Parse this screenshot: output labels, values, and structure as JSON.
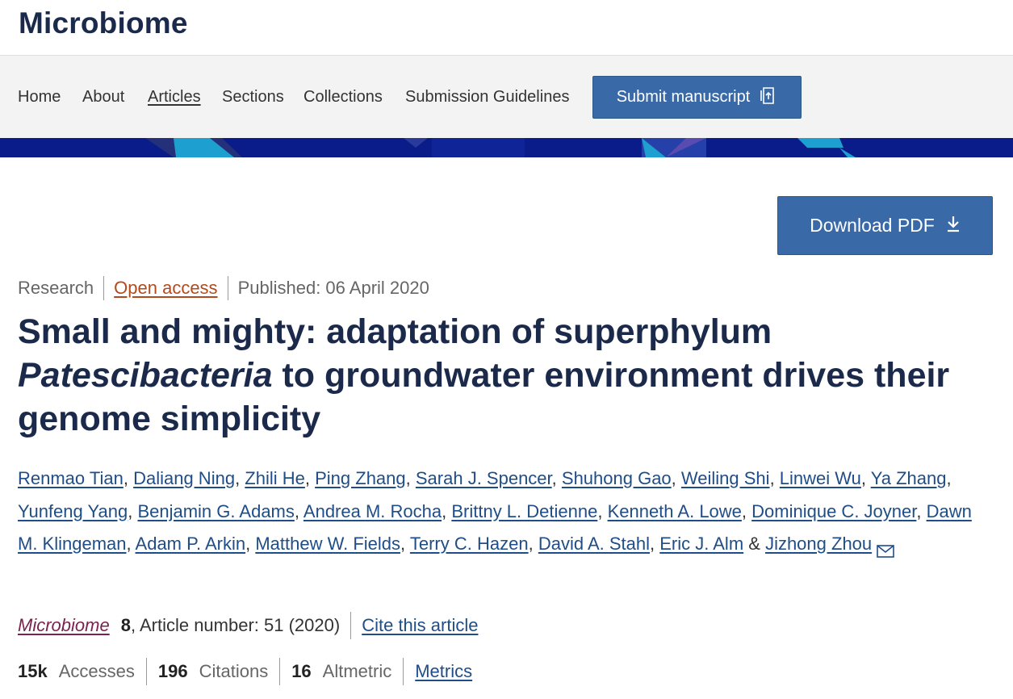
{
  "header": {
    "journal_title": "Microbiome"
  },
  "nav": {
    "items": [
      {
        "label": "Home"
      },
      {
        "label": "About"
      },
      {
        "label": "Articles"
      },
      {
        "label": "Sections"
      },
      {
        "label": "Collections"
      },
      {
        "label": "Submission Guidelines"
      }
    ],
    "submit_label": "Submit manuscript"
  },
  "download_pdf_label": "Download PDF",
  "article": {
    "type": "Research",
    "access": "Open access",
    "published": "Published: 06 April 2020",
    "title_part1": "Small and mighty: adaptation of superphylum",
    "title_italic": "Patescibacteria",
    "title_part2": "to groundwater environment drives their genome simplicity",
    "authors": [
      "Renmao Tian",
      "Daliang Ning",
      "Zhili He",
      "Ping Zhang",
      "Sarah J. Spencer",
      "Shuhong Gao",
      "Weiling Shi",
      "Linwei Wu",
      "Ya Zhang",
      "Yunfeng Yang",
      "Benjamin G. Adams",
      "Andrea M. Rocha",
      "Brittny L. Detienne",
      "Kenneth A. Lowe",
      "Dominique C. Joyner",
      "Dawn M. Klingeman",
      "Adam P. Arkin",
      "Matthew W. Fields",
      "Terry C. Hazen",
      "David A. Stahl",
      "Eric J. Alm",
      "Jizhong Zhou"
    ],
    "journal_name": "Microbiome",
    "volume": "8",
    "article_number": ", Article number: 51 (2020)",
    "cite_label": "Cite this article"
  },
  "metrics": {
    "accesses_value": "15k",
    "accesses_label": "Accesses",
    "citations_value": "196",
    "citations_label": "Citations",
    "altmetric_value": "16",
    "altmetric_label": "Altmetric",
    "metrics_link": "Metrics"
  },
  "colors": {
    "brand_navy": "#1b2a4a",
    "button_blue": "#3a69a7",
    "banner": "#0a1b8a",
    "link": "#1f4d87",
    "open_access": "#b34a1d",
    "journal_link": "#7b2250"
  },
  "icons": {
    "submit": "submit-doc-icon",
    "download": "download-icon",
    "email": "mail-icon"
  }
}
